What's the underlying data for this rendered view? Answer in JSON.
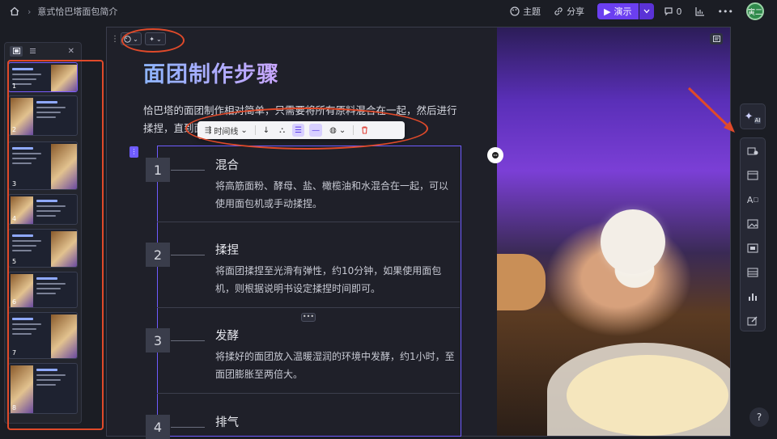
{
  "topbar": {
    "breadcrumb_title": "意式恰巴塔面包简介",
    "theme_label": "主题",
    "share_label": "分享",
    "present_label": "演示",
    "comment_count": "0",
    "avatar_text": "寅二"
  },
  "thumbnails": {
    "slides": [
      {
        "num": "1",
        "title": "意式恰巴塔面包简介"
      },
      {
        "num": "2",
        "title": ""
      },
      {
        "num": "3",
        "title": ""
      },
      {
        "num": "4",
        "title": ""
      },
      {
        "num": "5",
        "title": ""
      },
      {
        "num": "6",
        "title": ""
      },
      {
        "num": "7",
        "title": ""
      },
      {
        "num": "8",
        "title": ""
      }
    ]
  },
  "slide": {
    "title": "面团制作步骤",
    "intro": "恰巴塔的面团制作相对简单，只需要将所有原料混合在一起，然后进行揉捏，直到面",
    "steps": [
      {
        "num": "1",
        "title": "混合",
        "body": "将高筋面粉、酵母、盐、橄榄油和水混合在一起，可以使用面包机或手动揉捏。"
      },
      {
        "num": "2",
        "title": "揉捏",
        "body": "将面团揉捏至光滑有弹性，约10分钟，如果使用面包机，则根据说明书设定揉捏时间即可。"
      },
      {
        "num": "3",
        "title": "发酵",
        "body": "将揉好的面团放入温暖湿润的环境中发酵，约1小时，至面团膨胀至两倍大。"
      },
      {
        "num": "4",
        "title": "排气",
        "body": ""
      }
    ]
  },
  "toolbar": {
    "layout_label": "时间线"
  },
  "rail": {
    "ai_badge": "AI",
    "text_icon_label": "A"
  },
  "help_label": "?",
  "colors": {
    "accent": "#6b3ff0",
    "annotation_red": "#e04a2a",
    "selection": "#6f5cff"
  }
}
